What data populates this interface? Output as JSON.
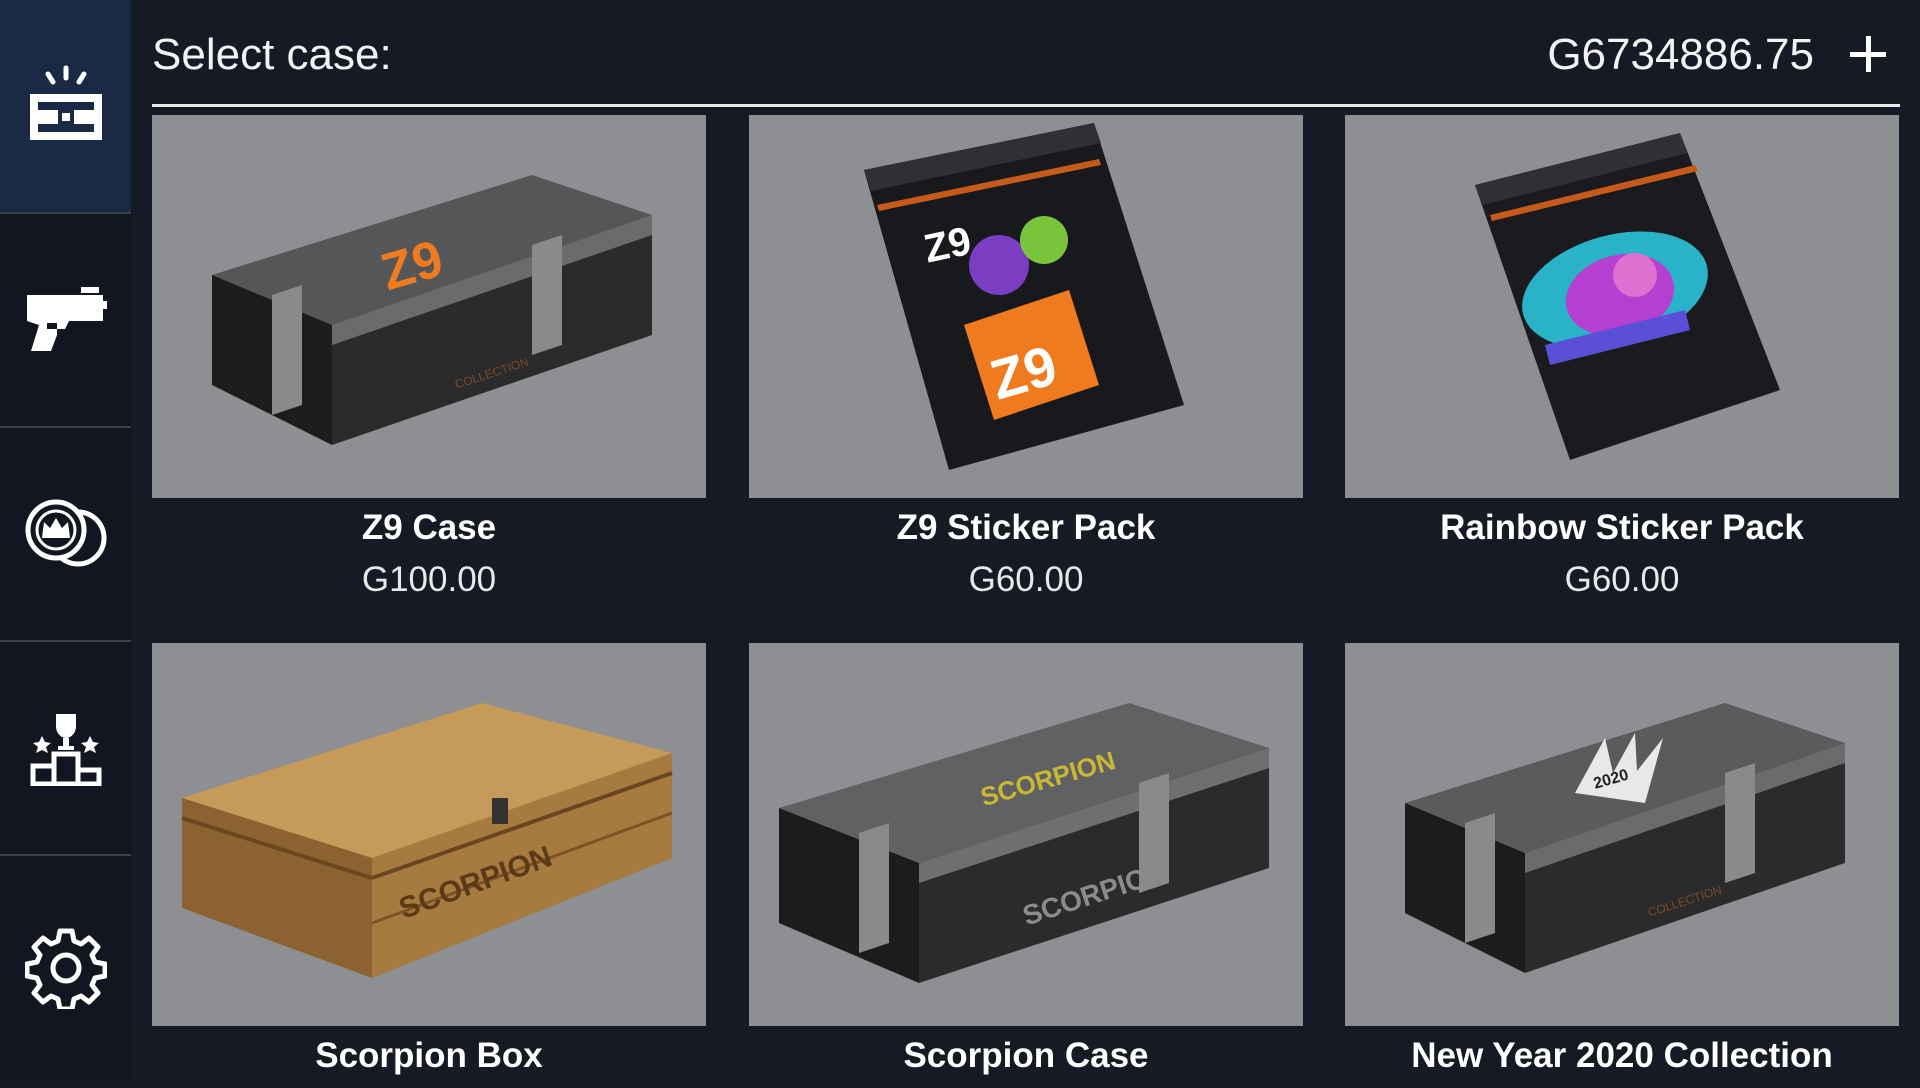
{
  "sidebar": {
    "items": [
      {
        "icon": "case-icon",
        "active": true
      },
      {
        "icon": "pistol-icon",
        "active": false
      },
      {
        "icon": "coins-icon",
        "active": false
      },
      {
        "icon": "leaderboard-icon",
        "active": false
      },
      {
        "icon": "gear-icon",
        "active": false
      }
    ]
  },
  "header": {
    "title": "Select case:",
    "balance": "G6734886.75",
    "add_icon": "plus-icon"
  },
  "cases": [
    {
      "name": "Z9 Case",
      "price": "G100.00",
      "image": "z9-case-image"
    },
    {
      "name": "Z9 Sticker Pack",
      "price": "G60.00",
      "image": "z9-sticker-pack-image"
    },
    {
      "name": "Rainbow Sticker Pack",
      "price": "G60.00",
      "image": "rainbow-sticker-pack-image"
    },
    {
      "name": "Scorpion Box",
      "price": "",
      "image": "scorpion-box-image"
    },
    {
      "name": "Scorpion Case",
      "price": "",
      "image": "scorpion-case-image"
    },
    {
      "name": "New Year 2020 Collection",
      "price": "",
      "image": "new-year-2020-case-image"
    }
  ],
  "art_text": {
    "z9_logo": "Z9",
    "collection": "COLLECTION",
    "scorpion": "SCORPION",
    "year": "2020"
  },
  "colors": {
    "background": "#161a25",
    "sidebar": "#121620",
    "sidebar_active": "#1b2a44",
    "card_bg": "#8e8f92",
    "accent_orange": "#f07a1e"
  }
}
